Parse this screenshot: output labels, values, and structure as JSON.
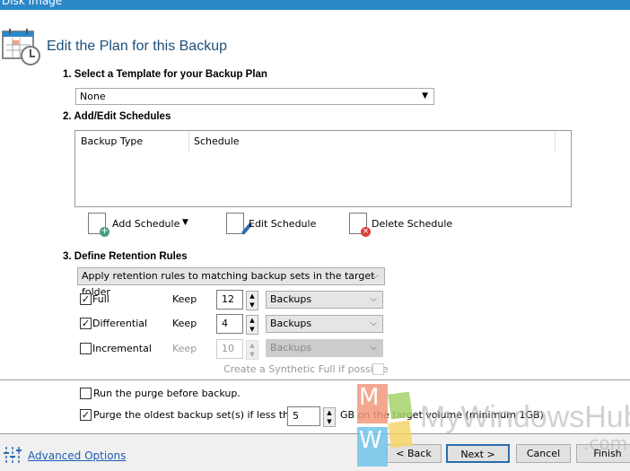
{
  "window": {
    "title": "Disk Image"
  },
  "header": {
    "title": "Edit the Plan for this Backup"
  },
  "section1": {
    "label": "1. Select a Template for your Backup Plan",
    "template_value": "None"
  },
  "section2": {
    "label": "2. Add/Edit Schedules",
    "columns": [
      "Backup Type",
      "Schedule"
    ],
    "add_label": "Add Schedule",
    "edit_label": "Edit Schedule",
    "delete_label": "Delete Schedule"
  },
  "section3": {
    "label": "3. Define Retention Rules",
    "mode": "Apply retention rules to matching backup sets in the target folder",
    "rows": [
      {
        "label": "Full",
        "checked": true,
        "keep_label": "Keep",
        "count": "12",
        "unit": "Backups",
        "enabled": true
      },
      {
        "label": "Differential",
        "checked": true,
        "keep_label": "Keep",
        "count": "4",
        "unit": "Backups",
        "enabled": true
      },
      {
        "label": "Incremental",
        "checked": false,
        "keep_label": "Keep",
        "count": "10",
        "unit": "Backups",
        "enabled": false
      }
    ],
    "synthetic_label": "Create a Synthetic Full if possible"
  },
  "purge": {
    "run_before_label": "Run the purge before backup.",
    "run_before_checked": false,
    "oldest_label": "Purge the oldest backup set(s) if less than",
    "oldest_checked": true,
    "gb_value": "5",
    "gb_suffix": "GB on the target volume (minimum 1GB)"
  },
  "footer": {
    "advanced_label": "Advanced Options",
    "back": "< Back",
    "next": "Next >",
    "cancel": "Cancel",
    "finish": "Finish"
  },
  "watermark": {
    "text": "MyWindowsHub",
    ".com": ".com",
    "letters": [
      "M",
      "W"
    ]
  },
  "colors": {
    "titlebar": "#2b88c9",
    "link": "#1a5fb4",
    "accent": "#2b6cb0"
  }
}
